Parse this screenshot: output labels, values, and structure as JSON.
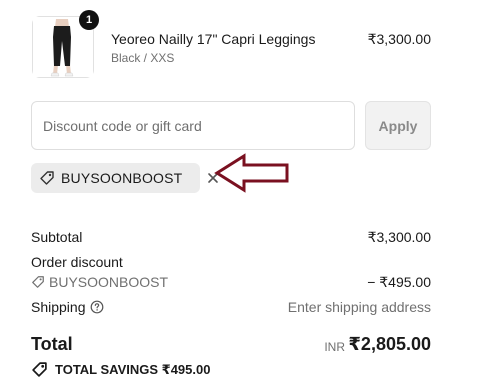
{
  "product": {
    "name": "Yeoreo Nailly 17\" Capri Leggings",
    "variant": "Black / XXS",
    "price": "₹3,300.00",
    "quantity": "1",
    "image_icon": "capri-leggings-image"
  },
  "discount_form": {
    "placeholder": "Discount code or gift card",
    "value": "",
    "apply_label": "Apply"
  },
  "applied_code": {
    "label": "BUYSOONBOOST",
    "tag_icon": "tag-icon",
    "remove_icon": "close-icon"
  },
  "annotation": {
    "icon": "left-arrow-outline",
    "color": "#7a1020"
  },
  "summary": {
    "subtotal_label": "Subtotal",
    "subtotal_value": "₹3,300.00",
    "order_discount_label": "Order discount",
    "discount_code": "BUYSOONBOOST",
    "discount_value": "− ₹495.00",
    "shipping_label": "Shipping",
    "shipping_help_icon": "help-circle-icon",
    "shipping_value": "Enter shipping address",
    "total_label": "Total",
    "total_currency": "INR",
    "total_value": "₹2,805.00",
    "savings_label": "TOTAL SAVINGS ₹495.00"
  }
}
